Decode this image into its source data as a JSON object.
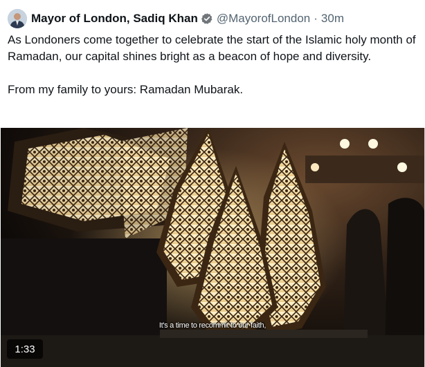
{
  "author": {
    "display_name": "Mayor of London, Sadiq Khan",
    "handle": "@MayorofLondon",
    "separator": "·",
    "time": "30m",
    "verified_icon": "verified-badge-icon",
    "verified_color": "#71767b"
  },
  "tweet": {
    "text": "As Londoners come together to celebrate the start of the Islamic holy month of Ramadan, our capital shines bright as a beacon of hope and diversity.\n\nFrom my family to yours: Ramadan Mubarak."
  },
  "video": {
    "caption": "It's a time to recommit to our faith,",
    "duration": "1:33"
  }
}
